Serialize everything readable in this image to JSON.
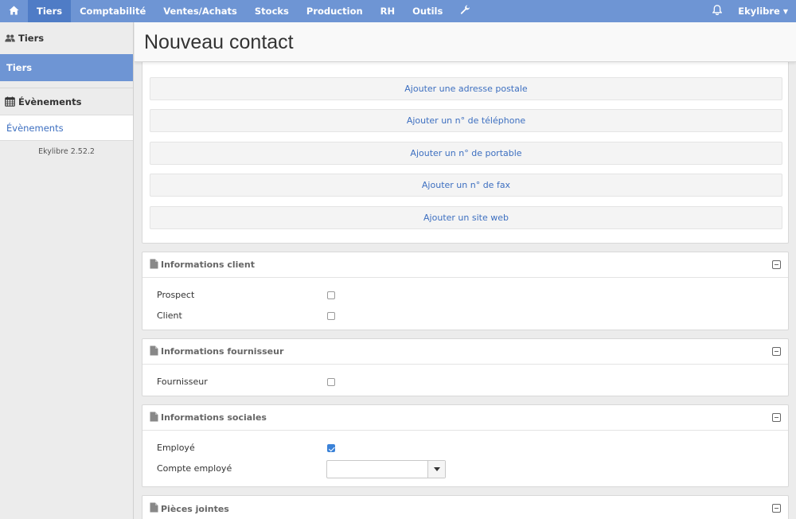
{
  "nav": {
    "home_icon": "home-icon",
    "items": [
      "Tiers",
      "Comptabilité",
      "Ventes/Achats",
      "Stocks",
      "Production",
      "RH",
      "Outils"
    ],
    "active": "Tiers",
    "tools_icon": "wrench-icon",
    "bell_icon": "bell-icon",
    "user": "Ekylibre",
    "accent_color": "#6e95d4",
    "active_color": "#4f7cc6"
  },
  "sidebar": {
    "sections": [
      {
        "title": "Tiers",
        "icon": "users-icon",
        "items": [
          {
            "label": "Tiers",
            "active": true
          }
        ]
      },
      {
        "title": "Évènements",
        "icon": "calendar-icon",
        "items": [
          {
            "label": "Évènements",
            "active": false
          }
        ]
      }
    ],
    "version": "Ekylibre 2.52.2"
  },
  "page": {
    "title": "Nouveau contact"
  },
  "add_buttons": [
    "Ajouter une adresse postale",
    "Ajouter un n° de téléphone",
    "Ajouter un n° de portable",
    "Ajouter un n° de fax",
    "Ajouter un site web"
  ],
  "panels": {
    "client": {
      "title": "Informations client",
      "fields": [
        {
          "label": "Prospect",
          "checked": false
        },
        {
          "label": "Client",
          "checked": false
        }
      ]
    },
    "supplier": {
      "title": "Informations fournisseur",
      "fields": [
        {
          "label": "Fournisseur",
          "checked": false
        }
      ]
    },
    "social": {
      "title": "Informations sociales",
      "employee_label": "Employé",
      "employee_checked": true,
      "account_label": "Compte employé",
      "account_value": ""
    },
    "attachments": {
      "title": "Pièces jointes"
    }
  }
}
